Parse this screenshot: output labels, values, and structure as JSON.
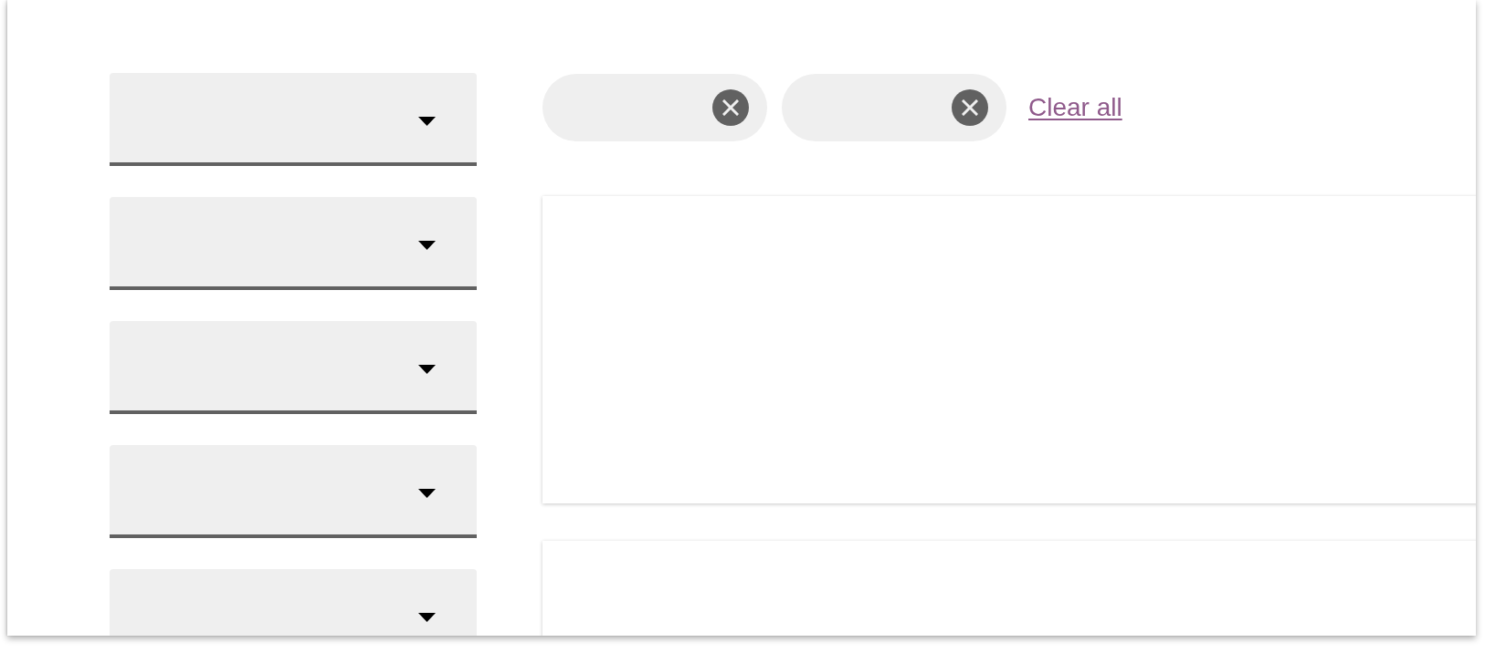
{
  "filter_dropdowns": [
    {
      "expanded": false
    },
    {
      "expanded": false
    },
    {
      "expanded": false
    },
    {
      "expanded": false
    },
    {
      "expanded": false
    }
  ],
  "active_filters": {
    "chips": [
      {
        "removable": true
      },
      {
        "removable": true
      }
    ],
    "clear_all": "Clear all"
  },
  "result_cards": [
    {
      "elevated": true
    },
    {
      "elevated": true
    }
  ]
}
